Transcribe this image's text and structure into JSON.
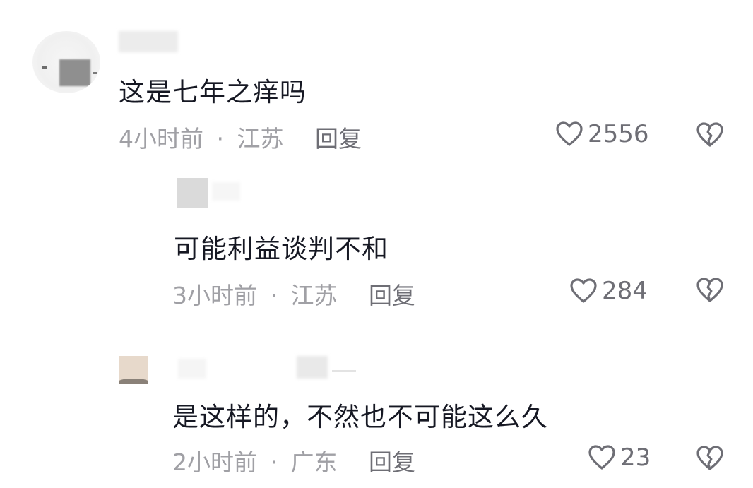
{
  "comments": [
    {
      "text": "这是七年之痒吗",
      "time": "4小时前",
      "sep": "·",
      "location": "江苏",
      "reply_label": "回复",
      "likes": "2556"
    },
    {
      "text": "可能利益谈判不和",
      "time": "3小时前",
      "sep": "·",
      "location": "江苏",
      "reply_label": "回复",
      "likes": "284"
    },
    {
      "text": "是这样的，不然也不可能这么久",
      "time": "2小时前",
      "sep": "·",
      "location": "广东",
      "reply_label": "回复",
      "likes": "23"
    }
  ],
  "icons": {
    "like": "heart-outline-icon",
    "dislike": "broken-heart-icon"
  },
  "colors": {
    "text": "#161823",
    "meta": "#a0a0a5",
    "icon": "#6e6e75"
  }
}
